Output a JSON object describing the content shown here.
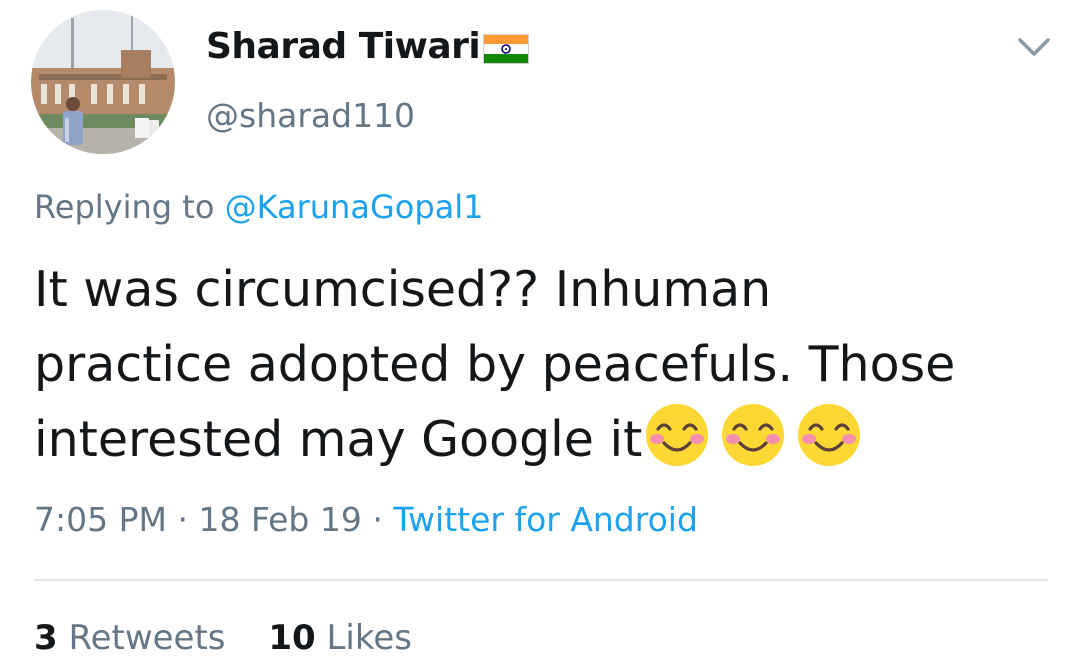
{
  "user": {
    "display_name": "Sharad Tiwari",
    "flag_icon": "india-flag-icon",
    "handle": "@sharad110"
  },
  "reply": {
    "prefix": "Replying to",
    "mention": "@KarunaGopal1"
  },
  "tweet": {
    "lines": [
      "It was circumcised?? Inhuman",
      "practice adopted by peacefuls. Those",
      "interested may Google it"
    ],
    "emoji": [
      "smiling-face-with-smiling-eyes",
      "smiling-face-with-smiling-eyes",
      "smiling-face-with-smiling-eyes"
    ]
  },
  "meta": {
    "time": "7:05 PM",
    "date": "18 Feb 19",
    "separator": "·",
    "source": "Twitter for Android"
  },
  "stats": {
    "retweets_count": "3",
    "retweets_label": "Retweets",
    "likes_count": "10",
    "likes_label": "Likes"
  },
  "colors": {
    "link": "#1da1f2",
    "secondary_text": "#657786",
    "primary_text": "#14171a",
    "divider": "#e1e8ed"
  }
}
